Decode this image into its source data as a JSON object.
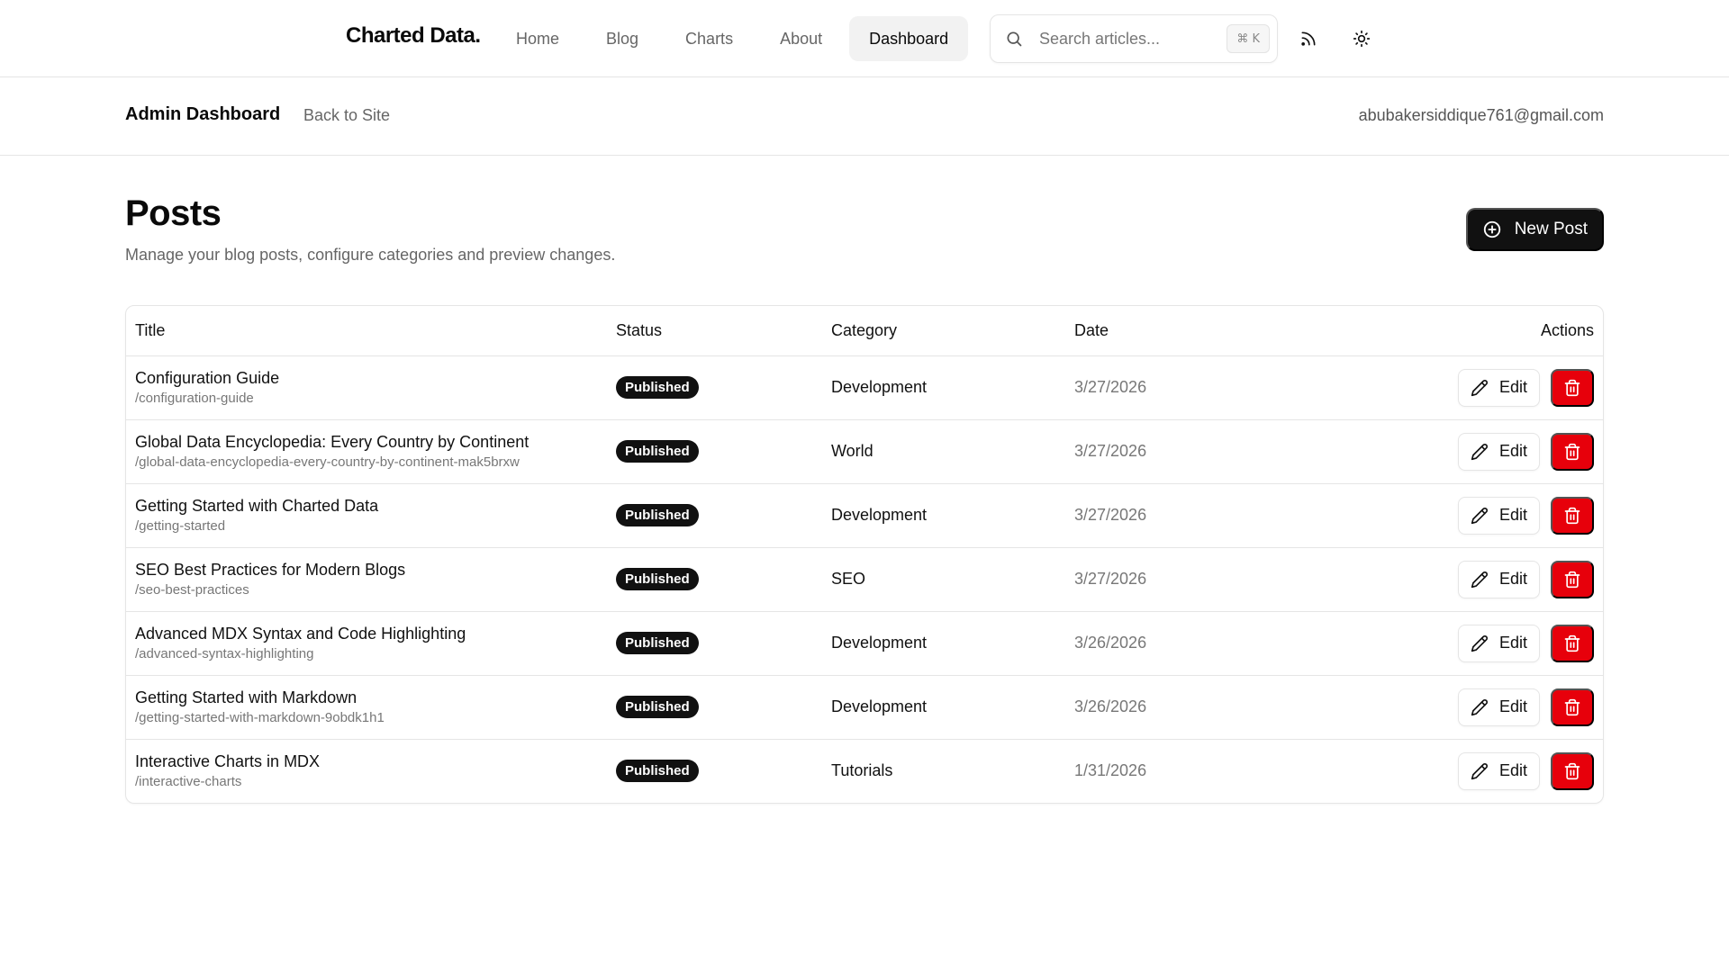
{
  "topnav": {
    "brand": "Charted Data",
    "brand_dot": ".",
    "links": [
      "Home",
      "Blog",
      "Charts",
      "About",
      "Dashboard"
    ],
    "active_link": "Dashboard",
    "search_placeholder": "Search articles...",
    "search_shortcut": "⌘ K",
    "icons": [
      "search-icon",
      "rss-icon",
      "sun-icon"
    ]
  },
  "adminbar": {
    "title": "Admin Dashboard",
    "back_link": "Back to Site",
    "email": "abubakersiddique761@gmail.com"
  },
  "posts": {
    "title": "Posts",
    "subtitle": "Manage your blog posts, configure categories and preview changes.",
    "new_post_label": "New Post",
    "columns": [
      "Title",
      "Status",
      "Category",
      "Date",
      "Actions"
    ],
    "edit_label": "Edit",
    "rows": [
      {
        "title": "Configuration Guide",
        "slug": "/configuration-guide",
        "status": "Published",
        "category": "Development",
        "date": "3/27/2026"
      },
      {
        "title": "Global Data Encyclopedia: Every Country by Continent",
        "slug": "/global-data-encyclopedia-every-country-by-continent-mak5brxw",
        "status": "Published",
        "category": "World",
        "date": "3/27/2026"
      },
      {
        "title": "Getting Started with Charted Data",
        "slug": "/getting-started",
        "status": "Published",
        "category": "Development",
        "date": "3/27/2026"
      },
      {
        "title": "SEO Best Practices for Modern Blogs",
        "slug": "/seo-best-practices",
        "status": "Published",
        "category": "SEO",
        "date": "3/27/2026"
      },
      {
        "title": "Advanced MDX Syntax and Code Highlighting",
        "slug": "/advanced-syntax-highlighting",
        "status": "Published",
        "category": "Development",
        "date": "3/26/2026"
      },
      {
        "title": "Getting Started with Markdown",
        "slug": "/getting-started-with-markdown-9obdk1h1",
        "status": "Published",
        "category": "Development",
        "date": "3/26/2026"
      },
      {
        "title": "Interactive Charts in MDX",
        "slug": "/interactive-charts",
        "status": "Published",
        "category": "Tutorials",
        "date": "1/31/2026"
      }
    ]
  },
  "colors": {
    "primary": "#111111",
    "danger": "#e7000b",
    "border": "#e5e5e5",
    "muted": "#777777"
  }
}
